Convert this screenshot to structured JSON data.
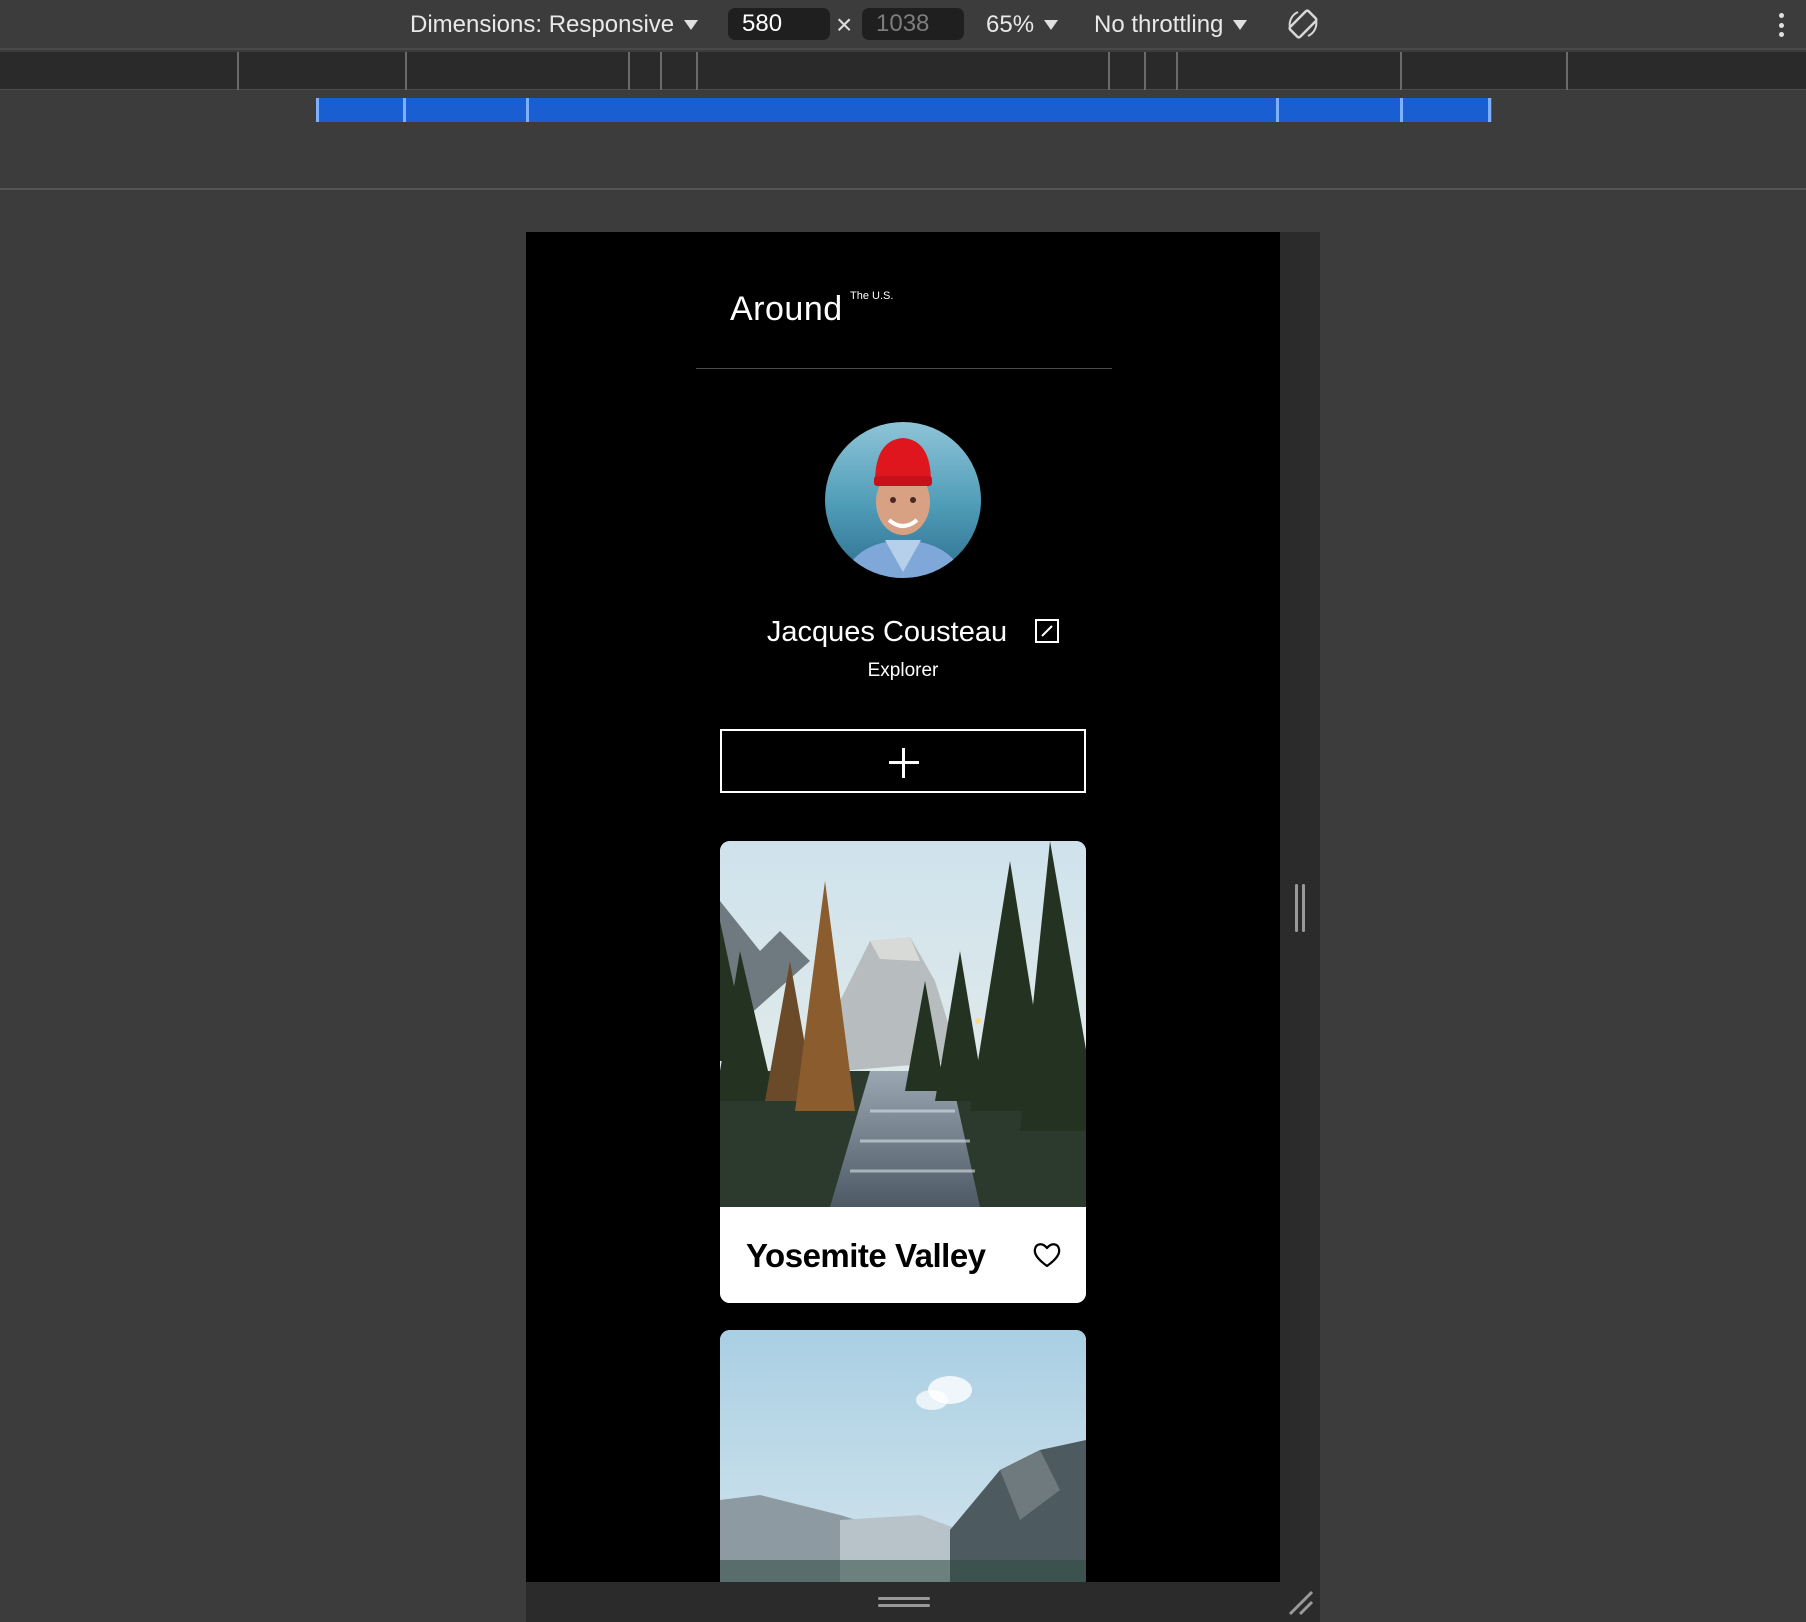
{
  "devtools": {
    "dimensions_label": "Dimensions: Responsive",
    "width_value": "580",
    "height_placeholder": "1038",
    "times_symbol": "×",
    "zoom_label": "65%",
    "throttling_label": "No throttling",
    "icons": {
      "rotate": "rotate-icon",
      "more": "more-options-icon",
      "caret": "chevron-down-icon"
    }
  },
  "page": {
    "logo": "Around",
    "logo_sup": "The U.S.",
    "profile": {
      "name": "Jacques Cousteau",
      "about": "Explorer",
      "edit_icon": "edit-icon",
      "avatar_alt": "Jacques Cousteau avatar"
    },
    "add_icon": "plus-icon",
    "cards": [
      {
        "title": "Yosemite Valley",
        "like_icon": "heart-icon"
      },
      {
        "title": ""
      }
    ]
  },
  "colors": {
    "devtools_bg": "#3c3c3c",
    "breakpoint_blue": "#1a5fd1",
    "page_bg": "#000000",
    "card_bg": "#ffffff"
  }
}
